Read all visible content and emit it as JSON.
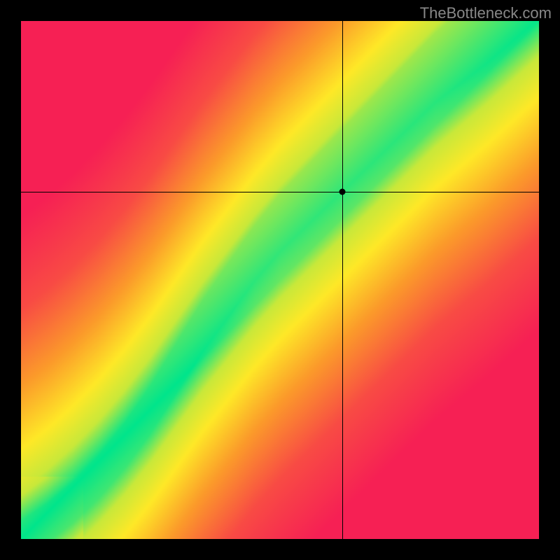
{
  "watermark": "TheBottleneck.com",
  "chart_data": {
    "type": "heatmap",
    "title": "",
    "xlabel": "",
    "ylabel": "",
    "xlim": [
      0,
      100
    ],
    "ylim": [
      0,
      100
    ],
    "marker": {
      "x": 62,
      "y": 67
    },
    "crosshair": {
      "x": 62,
      "y": 67
    },
    "colormap": {
      "description": "Distance-based gradient from green optimal curve, through yellow, orange, to red at extremes",
      "stops": [
        {
          "t": 0.0,
          "color": "#00E58C"
        },
        {
          "t": 0.12,
          "color": "#C8E83A"
        },
        {
          "t": 0.25,
          "color": "#FEE827"
        },
        {
          "t": 0.45,
          "color": "#FB9B2A"
        },
        {
          "t": 0.7,
          "color": "#F84B44"
        },
        {
          "t": 1.0,
          "color": "#F62054"
        }
      ]
    },
    "optimal_curve": {
      "description": "Green ridge curve y as function of x (normalized 0..1); superlinear near origin then roughly linear",
      "points": [
        {
          "x": 0.0,
          "y": 0.0
        },
        {
          "x": 0.05,
          "y": 0.03
        },
        {
          "x": 0.1,
          "y": 0.07
        },
        {
          "x": 0.15,
          "y": 0.12
        },
        {
          "x": 0.2,
          "y": 0.18
        },
        {
          "x": 0.25,
          "y": 0.25
        },
        {
          "x": 0.3,
          "y": 0.33
        },
        {
          "x": 0.35,
          "y": 0.41
        },
        {
          "x": 0.4,
          "y": 0.48
        },
        {
          "x": 0.45,
          "y": 0.55
        },
        {
          "x": 0.5,
          "y": 0.61
        },
        {
          "x": 0.55,
          "y": 0.66
        },
        {
          "x": 0.6,
          "y": 0.71
        },
        {
          "x": 0.65,
          "y": 0.76
        },
        {
          "x": 0.7,
          "y": 0.81
        },
        {
          "x": 0.75,
          "y": 0.86
        },
        {
          "x": 0.8,
          "y": 0.91
        },
        {
          "x": 0.85,
          "y": 0.95
        },
        {
          "x": 0.9,
          "y": 0.99
        },
        {
          "x": 1.0,
          "y": 1.08
        }
      ]
    }
  }
}
